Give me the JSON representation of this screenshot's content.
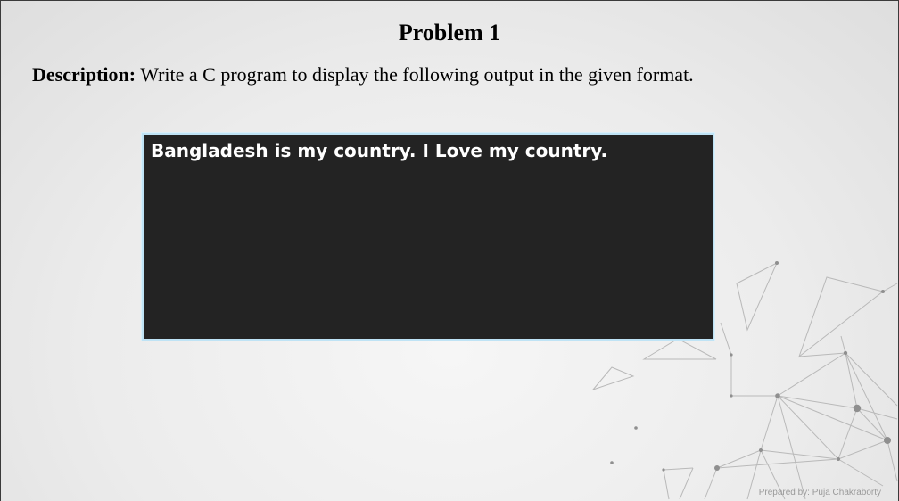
{
  "slide": {
    "title": "Problem 1",
    "description_label": "Description:",
    "description_text": " Write a C program to display the following output in the given format.",
    "console_output": "Bangladesh is my country. I Love my country.",
    "footer": "Prepared by: Puja Chakraborty"
  },
  "colors": {
    "console_bg": "#232323",
    "console_border": "#bfe3f5",
    "console_text": "#ffffff"
  }
}
